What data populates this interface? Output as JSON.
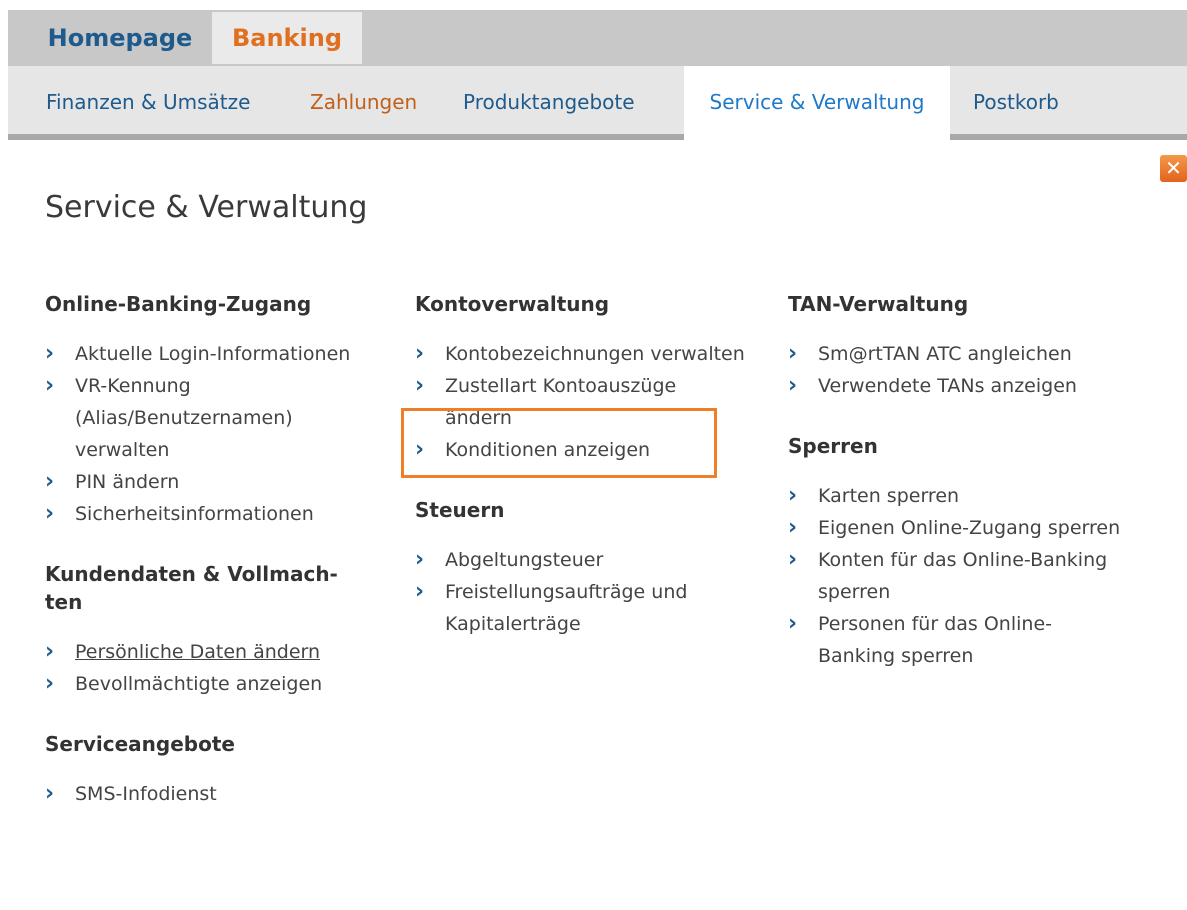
{
  "top_tabs": [
    "Homepage",
    "Banking"
  ],
  "sub_tabs": [
    "Finanzen & Umsätze",
    "Zahlungen",
    "Produktangebote",
    "Service & Verwaltung",
    "Postkorb"
  ],
  "close_label": "✕",
  "page_title": "Service & Verwaltung",
  "columns": [
    {
      "sections": [
        {
          "title": "Online-Banking-Zugang",
          "items": [
            "Aktuelle Login-Informationen",
            "VR-Kennung (Alias/Benutzernamen) verwalten",
            "PIN ändern",
            "Sicherheitsinformationen"
          ]
        },
        {
          "title": "Kundendaten & Vollmach-ten",
          "items": [
            "Persönliche Daten ändern",
            "Bevollmächtigte anzeigen"
          ]
        },
        {
          "title": "Serviceangebote",
          "items": [
            "SMS-Infodienst"
          ]
        }
      ]
    },
    {
      "sections": [
        {
          "title": "Kontoverwaltung",
          "items": [
            "Kontobezeichnungen verwalten",
            "Zustellart Kontoauszüge ändern",
            "Konditionen anzeigen"
          ]
        },
        {
          "title": "Steuern",
          "items": [
            "Abgeltungsteuer",
            "Freistellungsaufträge und Kapitalerträge"
          ]
        }
      ]
    },
    {
      "sections": [
        {
          "title": "TAN-Verwaltung",
          "items": [
            "Sm@rtTAN ATC angleichen",
            "Verwendete TANs anzeigen"
          ]
        },
        {
          "title": "Sperren",
          "items": [
            "Karten sperren",
            "Eigenen Online-Zugang sperren",
            "Konten für das Online-Banking sperren",
            "Personen für das Online-Banking sperren"
          ]
        }
      ]
    }
  ]
}
